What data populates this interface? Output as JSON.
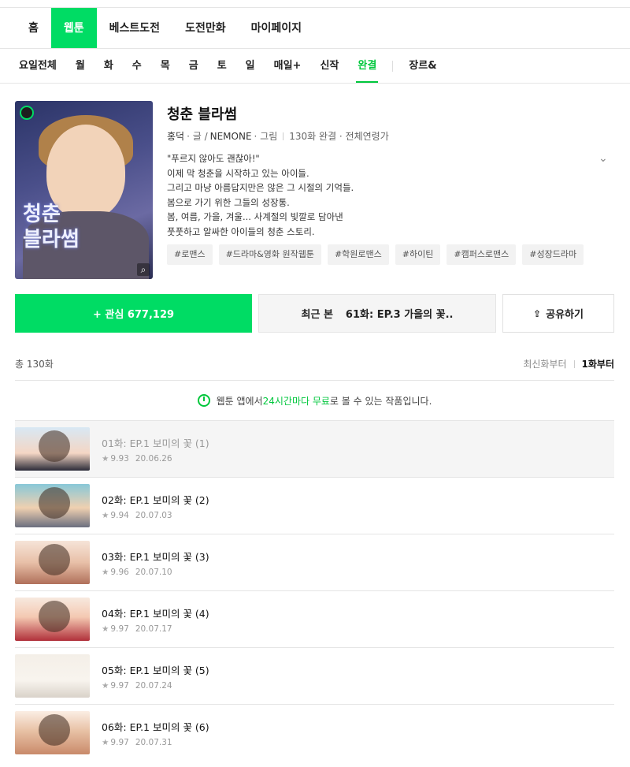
{
  "nav": {
    "main": [
      "홈",
      "웹툰",
      "베스트도전",
      "도전만화",
      "마이페이지"
    ],
    "sub": [
      "요일전체",
      "월",
      "화",
      "수",
      "목",
      "금",
      "토",
      "일",
      "매일+",
      "신작",
      "완결",
      "장르&"
    ]
  },
  "webtoon": {
    "thumb_title": "청춘\n블라썸",
    "title": "청춘 블라썸",
    "author": "홍덕",
    "author_role": "· 글 /",
    "artist": "NEMONE",
    "artist_role": "· 그림",
    "status": "130화 완결 · 전체연령가",
    "synopsis": [
      "\"푸르지 않아도 괜찮아!\"",
      "이제 막 청춘을 시작하고 있는 아이들.",
      "그리고 마냥 아름답지만은 않은 그 시절의 기억들.",
      "봄으로 가기 위한 그들의 성장통.",
      "봄, 여름, 가을, 겨울... 사계절의 빛깔로 담아낸",
      "풋풋하고 알싸한 아이들의 청춘 스토리."
    ],
    "tags": [
      "#로맨스",
      "#드라마&영화 원작웹툰",
      "#학원로맨스",
      "#하이틴",
      "#캠퍼스로맨스",
      "#성장드라마"
    ]
  },
  "actions": {
    "favorite": "+ 관심 677,129",
    "recent_label": "최근 본",
    "recent_episode": "61화: EP.3 가을의 꽃..",
    "share": "공유하기"
  },
  "list": {
    "total": "총 130화",
    "sort_newest": "최신화부터",
    "sort_first": "1화부터",
    "free_prefix": "웹툰 앱에서 ",
    "free_highlight": "24시간마다 무료",
    "free_suffix": "로 볼 수 있는 작품입니다."
  },
  "episodes": [
    {
      "title": "01화: EP.1 보미의 꽃 (1)",
      "rating": "9.93",
      "date": "20.06.26"
    },
    {
      "title": "02화: EP.1 보미의 꽃 (2)",
      "rating": "9.94",
      "date": "20.07.03"
    },
    {
      "title": "03화: EP.1 보미의 꽃 (3)",
      "rating": "9.96",
      "date": "20.07.10"
    },
    {
      "title": "04화: EP.1 보미의 꽃 (4)",
      "rating": "9.97",
      "date": "20.07.17"
    },
    {
      "title": "05화: EP.1 보미의 꽃 (5)",
      "rating": "9.97",
      "date": "20.07.24"
    },
    {
      "title": "06화: EP.1 보미의 꽃 (6)",
      "rating": "9.97",
      "date": "20.07.31"
    }
  ],
  "icons": {
    "star": "★",
    "expand": "chevron-down-icon",
    "share": "share-icon",
    "clock": "clock-icon",
    "zoom": "magnifier-icon"
  },
  "colors": {
    "accent": "#00dc64",
    "accent_text": "#00c73c"
  }
}
